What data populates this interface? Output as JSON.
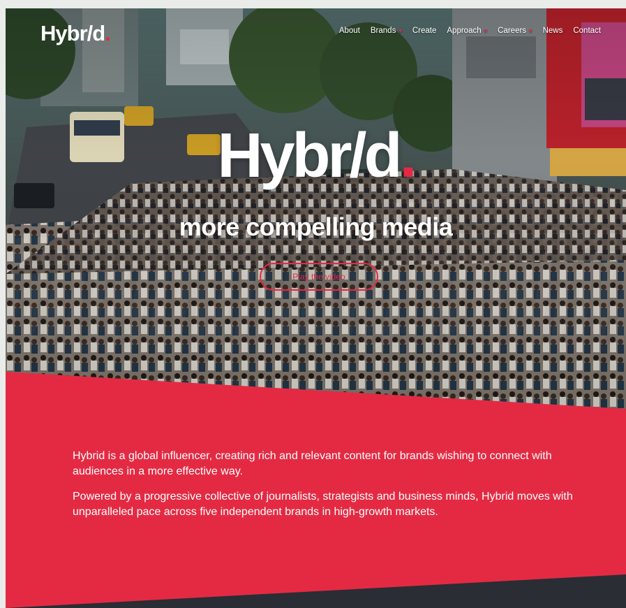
{
  "nav": {
    "logo_main": "Hybr/d",
    "logo_dot": ".",
    "items": [
      {
        "label": "About",
        "dropdown": false
      },
      {
        "label": "Brands",
        "dropdown": true
      },
      {
        "label": "Create",
        "dropdown": false
      },
      {
        "label": "Approach",
        "dropdown": true
      },
      {
        "label": "Careers",
        "dropdown": true
      },
      {
        "label": "News",
        "dropdown": false
      },
      {
        "label": "Contact",
        "dropdown": false
      }
    ],
    "dropdown_icon": "chevron-down-icon"
  },
  "hero": {
    "logo_main": "Hybr/d",
    "logo_dot": ".",
    "tagline": "more compelling media",
    "button_label": "Play the video"
  },
  "about": {
    "paragraph_1": "Hybrid is a global influencer, creating rich and relevant content for brands wishing to connect with audiences in a more effective way.",
    "paragraph_2": "Powered by a progressive collective of journalists, strategists and business minds, Hybrid moves with unparalleled pace across five independent brands in high-growth markets."
  },
  "colors": {
    "accent": "#e42a43",
    "dark_footer": "#2a2d33",
    "text_light": "#ffffff"
  }
}
